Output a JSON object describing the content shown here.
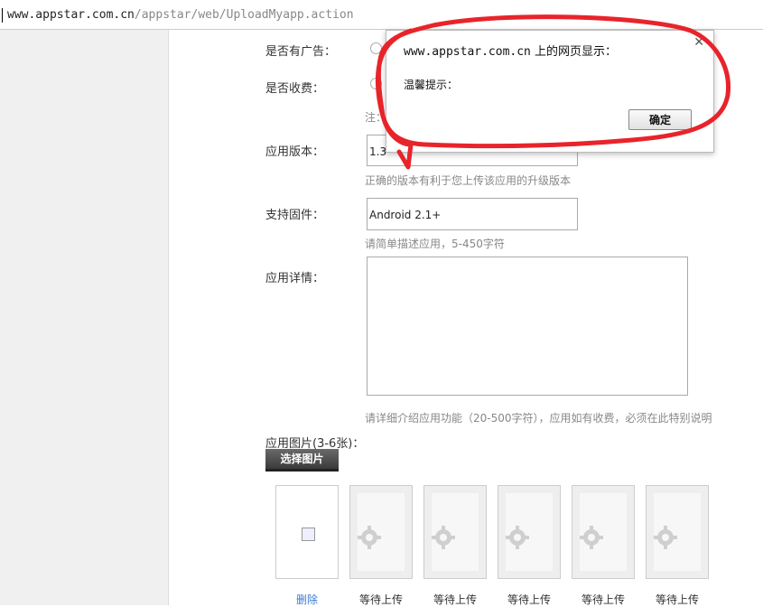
{
  "browser": {
    "url_host": "www.appstar.com.cn",
    "url_rest": "/appstar/web/UploadMyapp.action"
  },
  "form": {
    "ads_label": "是否有广告：",
    "fee_label": "是否收费：",
    "note_prefix": "注：",
    "version_label": "应用版本：",
    "version_value": "1.3",
    "version_hint": "正确的版本有利于您上传该应用的升级版本",
    "firmware_label": "支持固件：",
    "firmware_value": "Android 2.1+",
    "firmware_hint": "请简单描述应用，5-450字符",
    "detail_label": "应用详情：",
    "detail_value": "",
    "detail_hint": "请详细介绍应用功能（20-500字符），应用如有收费，必须在此特别说明",
    "images_label": "应用图片(3-6张)：",
    "choose_button": "选择图片"
  },
  "thumbnails": [
    {
      "caption": "删除",
      "state": "broken-image"
    },
    {
      "caption": "等待上传",
      "state": "placeholder"
    },
    {
      "caption": "等待上传",
      "state": "placeholder"
    },
    {
      "caption": "等待上传",
      "state": "placeholder"
    },
    {
      "caption": "等待上传",
      "state": "placeholder"
    },
    {
      "caption": "等待上传",
      "state": "placeholder"
    }
  ],
  "dialog": {
    "title_host": "www.appstar.com.cn",
    "title_suffix": " 上的网页显示：",
    "message": "温馨提示：",
    "ok_button": "确定",
    "close_icon": "close-icon"
  },
  "colors": {
    "annotation_red": "#e8242b",
    "link_blue": "#3a7bd5"
  }
}
